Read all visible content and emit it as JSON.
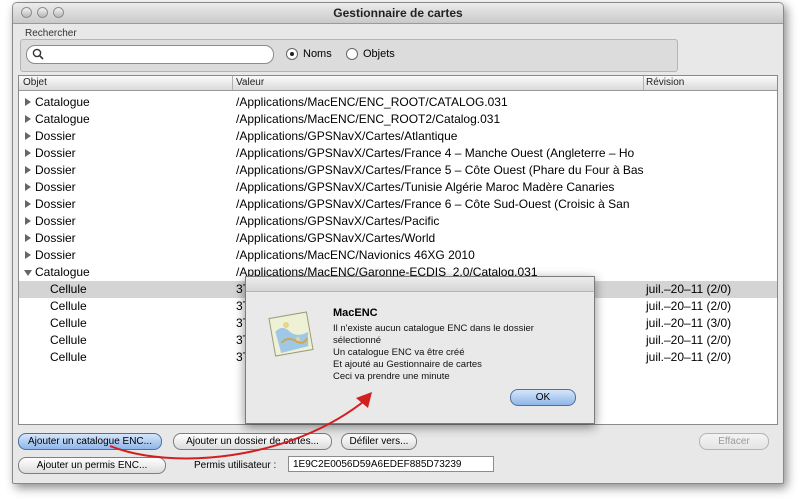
{
  "window": {
    "title": "Gestionnaire de cartes"
  },
  "search": {
    "label": "Rechercher",
    "value": "",
    "options": [
      {
        "label": "Noms",
        "selected": true
      },
      {
        "label": "Objets",
        "selected": false
      }
    ]
  },
  "table": {
    "columns": [
      "Objet",
      "Valeur",
      "Révision"
    ],
    "rows": [
      {
        "objet": "Catalogue",
        "valeur": "/Applications/MacENC/ENC_ROOT/CATALOG.031",
        "revision": "",
        "expanded": false
      },
      {
        "objet": "Catalogue",
        "valeur": "/Applications/MacENC/ENC_ROOT2/Catalog.031",
        "revision": "",
        "expanded": false
      },
      {
        "objet": "Dossier",
        "valeur": "/Applications/GPSNavX/Cartes/Atlantique",
        "revision": "",
        "expanded": false
      },
      {
        "objet": "Dossier",
        "valeur": "/Applications/GPSNavX/Cartes/France 4 – Manche Ouest (Angleterre – Ho",
        "revision": "",
        "expanded": false
      },
      {
        "objet": "Dossier",
        "valeur": "/Applications/GPSNavX/Cartes/France 5 – Côte Ouest (Phare du Four à Bas",
        "revision": "",
        "expanded": false
      },
      {
        "objet": "Dossier",
        "valeur": "/Applications/GPSNavX/Cartes/Tunisie Algérie Maroc Madère Canaries",
        "revision": "",
        "expanded": false
      },
      {
        "objet": "Dossier",
        "valeur": "/Applications/GPSNavX/Cartes/France 6 – Côte Sud-Ouest (Croisic à San",
        "revision": "",
        "expanded": false
      },
      {
        "objet": "Dossier",
        "valeur": "/Applications/GPSNavX/Cartes/Pacific",
        "revision": "",
        "expanded": false
      },
      {
        "objet": "Dossier",
        "valeur": "/Applications/GPSNavX/Cartes/World",
        "revision": "",
        "expanded": false
      },
      {
        "objet": "Dossier",
        "valeur": "/Applications/MacENC/Navionics 46XG 2010",
        "revision": "",
        "expanded": false
      },
      {
        "objet": "Catalogue",
        "valeur": "/Applications/MacENC/Garonne-ECDIS_2.0/Catalog.031",
        "revision": "",
        "expanded": true
      },
      {
        "objet": "Cellule",
        "valeur": "3T",
        "revision": "juil.–20–11 (2/0)",
        "child": true,
        "selected": true
      },
      {
        "objet": "Cellule",
        "valeur": "3T",
        "revision": "juil.–20–11 (2/0)",
        "child": true
      },
      {
        "objet": "Cellule",
        "valeur": "3T",
        "revision": "juil.–20–11 (3/0)",
        "child": true
      },
      {
        "objet": "Cellule",
        "valeur": "3T",
        "revision": "juil.–20–11 (2/0)",
        "child": true
      },
      {
        "objet": "Cellule",
        "valeur": "3T",
        "revision": "juil.–20–11 (2/0)",
        "child": true
      }
    ]
  },
  "dialog": {
    "title": "MacENC",
    "lines": [
      "Il n'existe aucun catalogue ENC dans le dossier",
      "sélectionné",
      "Un catalogue ENC va être créé",
      "Et ajouté au Gestionnaire de cartes",
      "Ceci va prendre une minute"
    ],
    "ok": "OK"
  },
  "buttons": {
    "add_catalog": "Ajouter un catalogue ENC...",
    "add_folder": "Ajouter un dossier de cartes...",
    "scroll_to": "Défiler vers...",
    "clear": "Effacer",
    "add_permit": "Ajouter un permis ENC..."
  },
  "permit": {
    "label": "Permis utilisateur :",
    "value": "1E9C2E0056D59A6EDEF885D73239"
  },
  "colors": {
    "annotation_arrow": "#d21f1f",
    "selection": "#d4d4d4",
    "button_blue": "#8fb6e9"
  }
}
